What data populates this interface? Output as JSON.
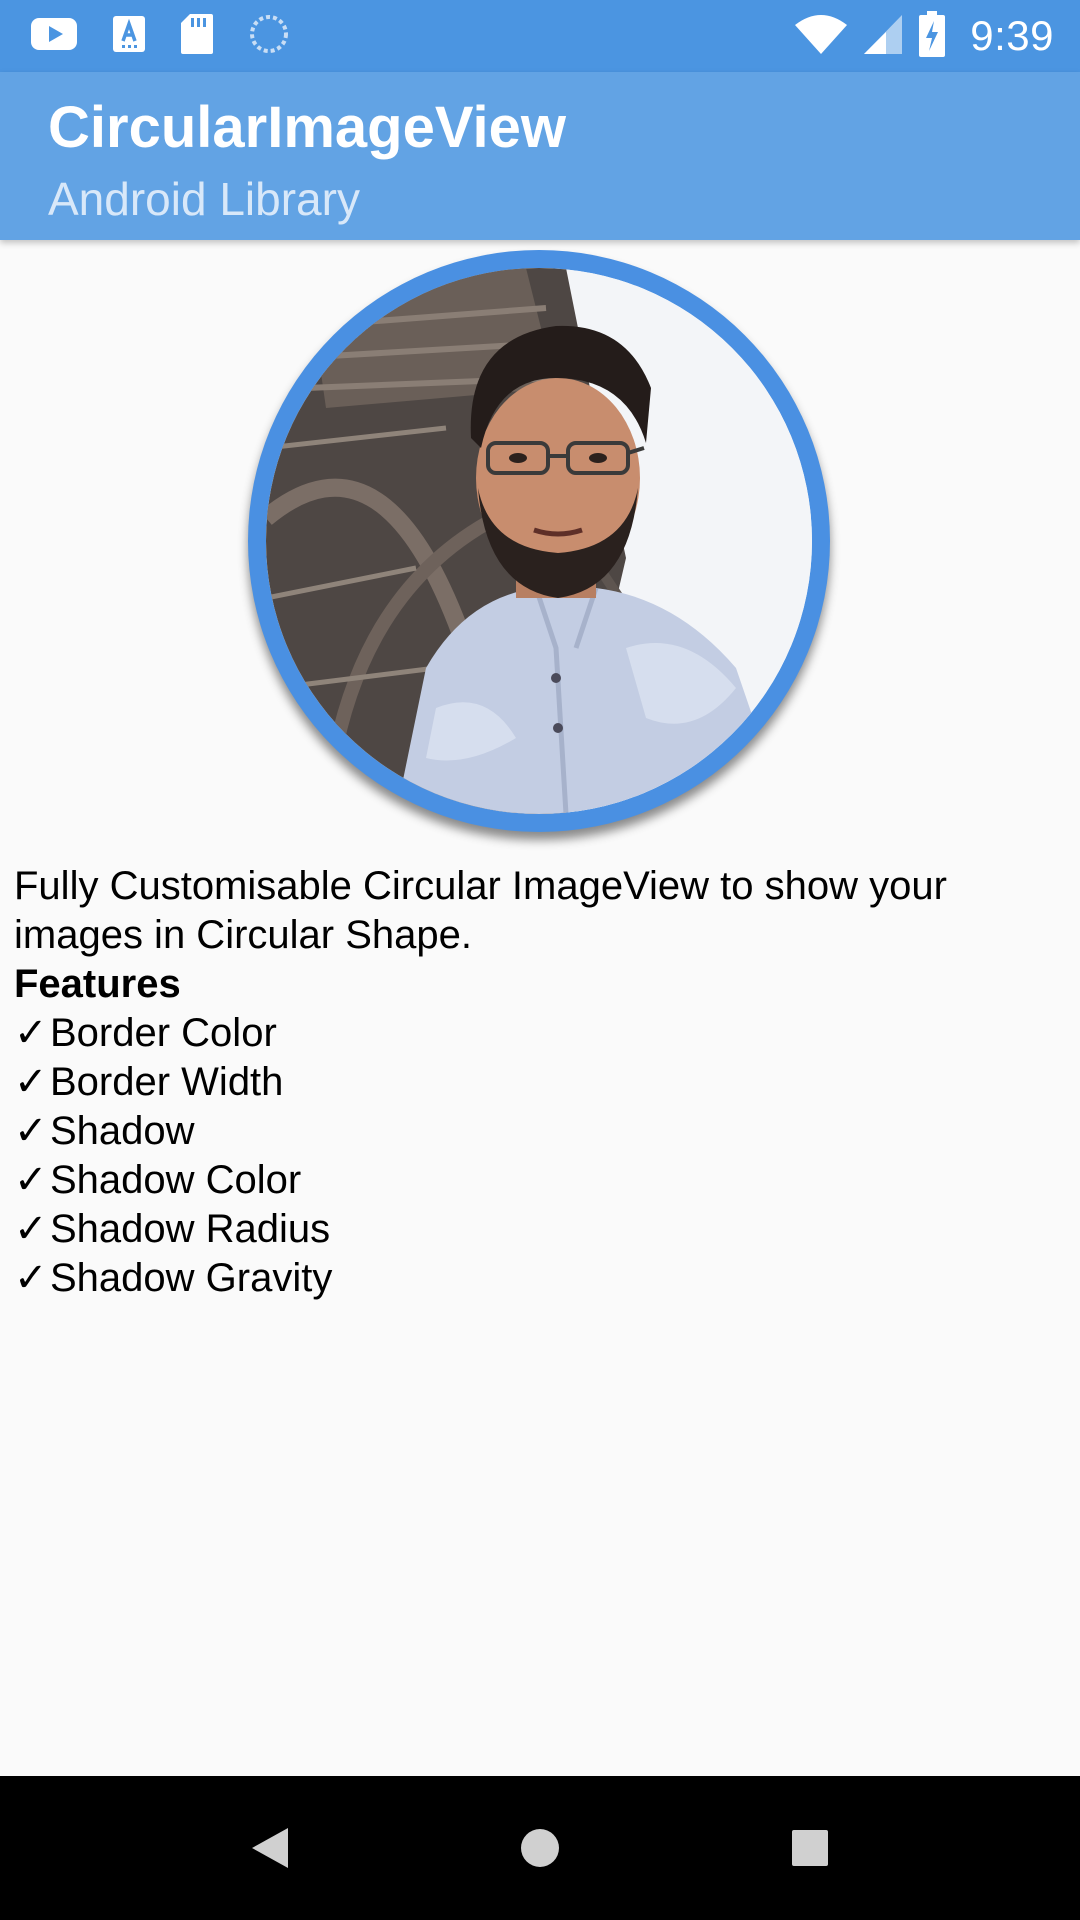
{
  "status_bar": {
    "time": "9:39",
    "left_icons": [
      "youtube-icon",
      "font-download-icon",
      "sd-card-icon",
      "sync-progress-icon"
    ],
    "right_icons": [
      "wifi-icon",
      "cell-signal-icon",
      "battery-charging-icon"
    ]
  },
  "app_bar": {
    "title": "CircularImageView",
    "subtitle": "Android Library"
  },
  "colors": {
    "status_bar": "#4b95e1",
    "app_bar": "#62a3e4",
    "border": "#4a90e2",
    "background": "#fafafa"
  },
  "content": {
    "description": "Fully Customisable Circular ImageView to show your images in Circular Shape.",
    "features_heading": "Features",
    "check_mark": "✓",
    "features": [
      "Border Color",
      "Border Width",
      "Shadow",
      "Shadow Color",
      "Shadow Radius",
      "Shadow Gravity"
    ]
  },
  "nav_bar": {
    "buttons": [
      "back-icon",
      "home-icon",
      "recents-icon"
    ]
  }
}
